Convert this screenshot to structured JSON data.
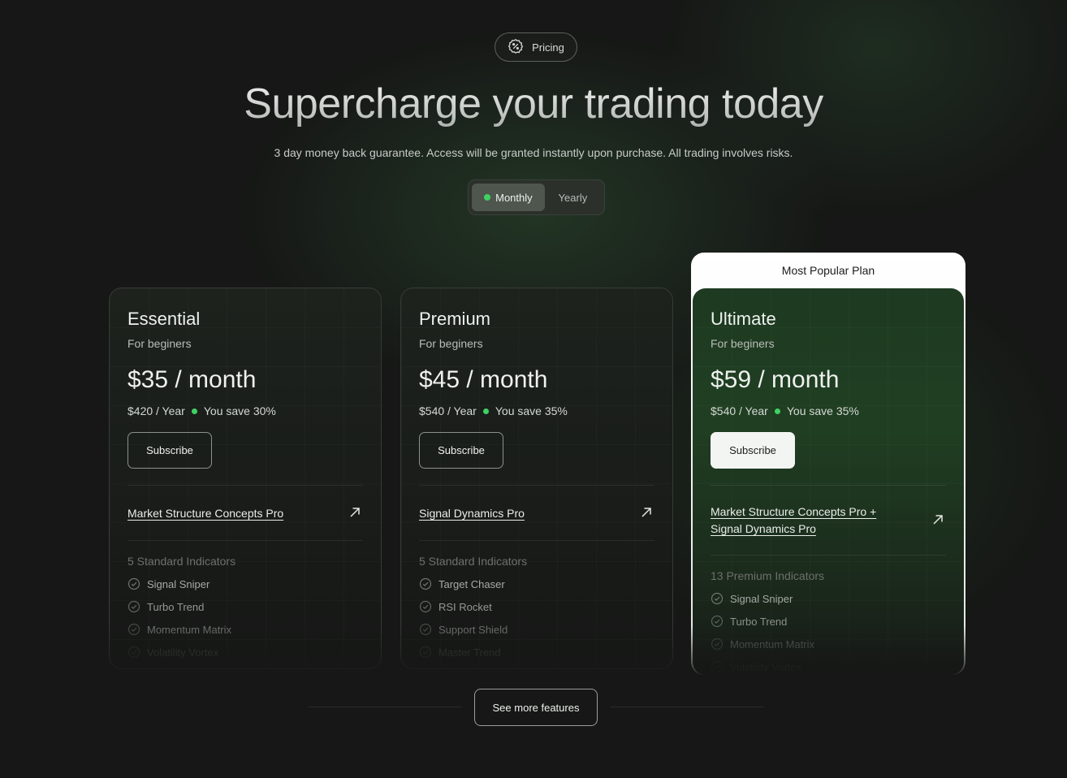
{
  "badge": {
    "label": "Pricing",
    "icon": "discount-badge-icon"
  },
  "headline": "Supercharge your trading today",
  "subtitle": "3 day money back guarantee. Access will be granted instantly upon purchase. All trading involves risks.",
  "billing_toggle": {
    "options": [
      "Monthly",
      "Yearly"
    ],
    "selected": "Monthly"
  },
  "colors": {
    "accent_green": "#3ed262",
    "background": "#161716"
  },
  "plans": [
    {
      "name": "Essential",
      "audience": "For beginers",
      "price": "$35 / month",
      "yearly_price": "$420 / Year",
      "savings": "You save 30%",
      "button": "Subscribe",
      "product_lines": [
        "Market Structure Concepts Pro"
      ],
      "features_heading": "5 Standard Indicators",
      "features": [
        "Signal Sniper",
        "Turbo Trend",
        "Momentum Matrix",
        "Volatility Vortex"
      ]
    },
    {
      "name": "Premium",
      "audience": "For beginers",
      "price": "$45 / month",
      "yearly_price": "$540 / Year",
      "savings": "You save 35%",
      "button": "Subscribe",
      "product_lines": [
        "Signal Dynamics Pro"
      ],
      "features_heading": "5 Standard Indicators",
      "features": [
        "Target Chaser",
        "RSI Rocket",
        "Support Shield",
        "Master Trend"
      ]
    },
    {
      "tag": "Most Popular Plan",
      "name": "Ultimate",
      "audience": "For beginers",
      "price": "$59 / month",
      "yearly_price": "$540 / Year",
      "savings": "You save 35%",
      "button": "Subscribe",
      "product_lines": [
        "Market Structure Concepts Pro +",
        "Signal Dynamics Pro"
      ],
      "features_heading": "13 Premium Indicators",
      "features": [
        "Signal Sniper",
        "Turbo Trend",
        "Momentum Matrix",
        "Volatility Vortex"
      ]
    }
  ],
  "see_more": "See more features"
}
